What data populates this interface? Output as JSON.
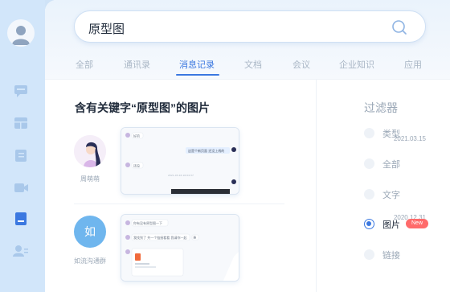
{
  "search": {
    "query": "原型图"
  },
  "tabs": [
    {
      "label": "全部"
    },
    {
      "label": "通讯录"
    },
    {
      "label": "消息记录",
      "active": true
    },
    {
      "label": "文档"
    },
    {
      "label": "会议"
    },
    {
      "label": "企业知识"
    },
    {
      "label": "应用"
    }
  ],
  "results": {
    "title": "含有关键字“原型图”的图片",
    "items": [
      {
        "name": "周萌萌",
        "date": "2021.03.15",
        "chat": [
          "好的",
          "这是个新页面 还没上线的",
          "还没",
          "2021-03-16 16:04:37"
        ]
      },
      {
        "name": "如流沟通群",
        "avatar_text": "如",
        "date": "2020.12.31",
        "chat": [
          "你有没有原型图一下",
          "我找到了 共一个链接看看 我请你一起",
          "确"
        ]
      }
    ]
  },
  "filter": {
    "title": "过滤器",
    "options": [
      {
        "label": "类型"
      },
      {
        "label": "全部"
      },
      {
        "label": "文字"
      },
      {
        "label": "图片",
        "selected": true,
        "badge": "New"
      },
      {
        "label": "链接"
      }
    ]
  },
  "colors": {
    "accent": "#3b78e0",
    "badge": "#ff6b6b",
    "rail": "#d2e6fa"
  }
}
